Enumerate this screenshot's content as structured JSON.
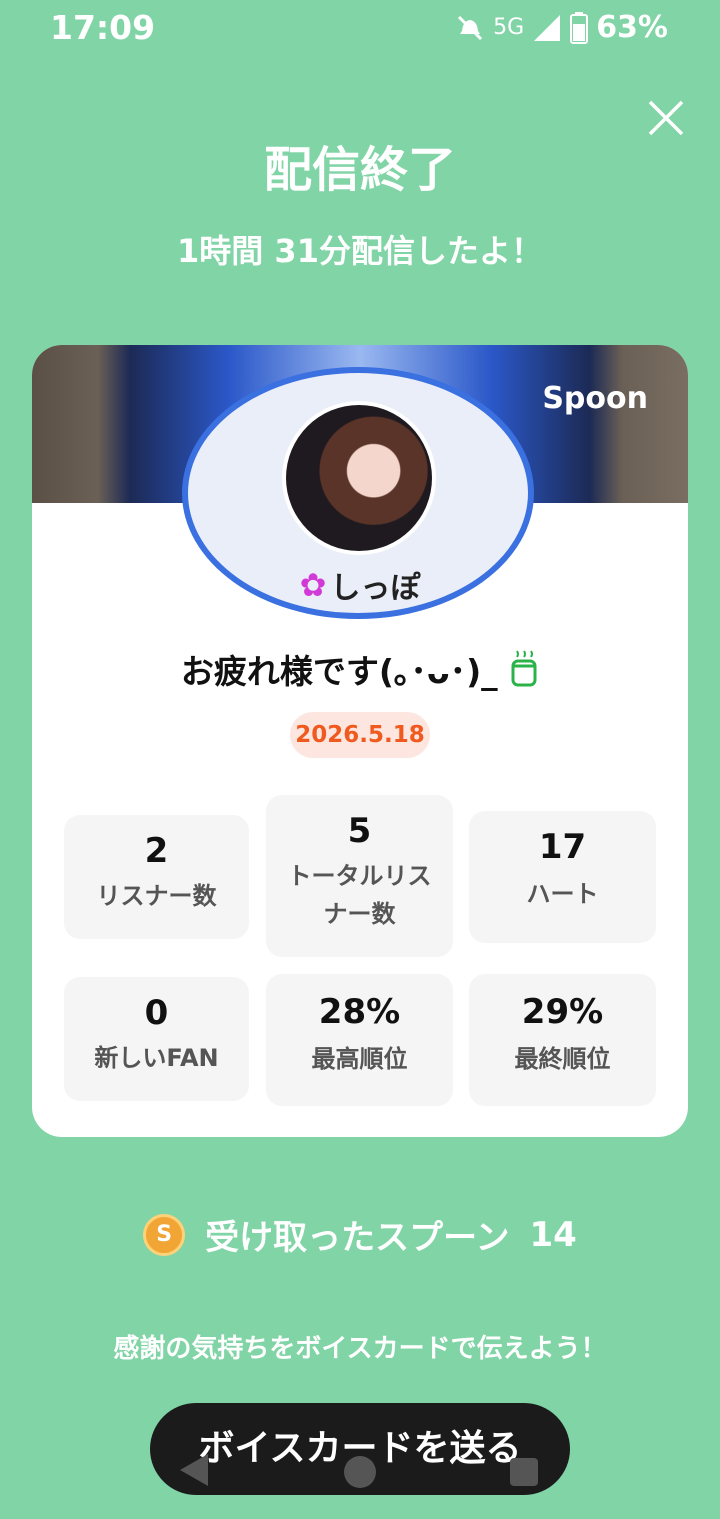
{
  "status_bar": {
    "time": "17:09",
    "network": "5G",
    "battery": "63%",
    "icons": [
      "mute-icon",
      "signal-icon",
      "battery-icon"
    ]
  },
  "header": {
    "title": "配信終了",
    "subtitle": "1時間 31分配信したよ！"
  },
  "card": {
    "brand": "Spoon",
    "user_name": "しっぽ",
    "message": "お疲れ様です(｡･ᴗ･)_",
    "message_icon": "cup-icon",
    "date": "2026.5.18",
    "stats": [
      {
        "value": "2",
        "label": "リスナー数"
      },
      {
        "value": "5",
        "label": "トータルリスナー数"
      },
      {
        "value": "17",
        "label": "ハート"
      },
      {
        "value": "0",
        "label": "新しいFAN"
      },
      {
        "value": "28%",
        "label": "最高順位"
      },
      {
        "value": "29%",
        "label": "最終順位"
      }
    ]
  },
  "spoons": {
    "coin_letter": "S",
    "label": "受け取ったスプーン",
    "count": "14"
  },
  "thanks_text": "感謝の気持ちをボイスカードで伝えよう！",
  "send_button": "ボイスカードを送る",
  "colors": {
    "background": "#80d4a6",
    "accent_date": "#f05a1e",
    "button": "#1b1b1b"
  }
}
